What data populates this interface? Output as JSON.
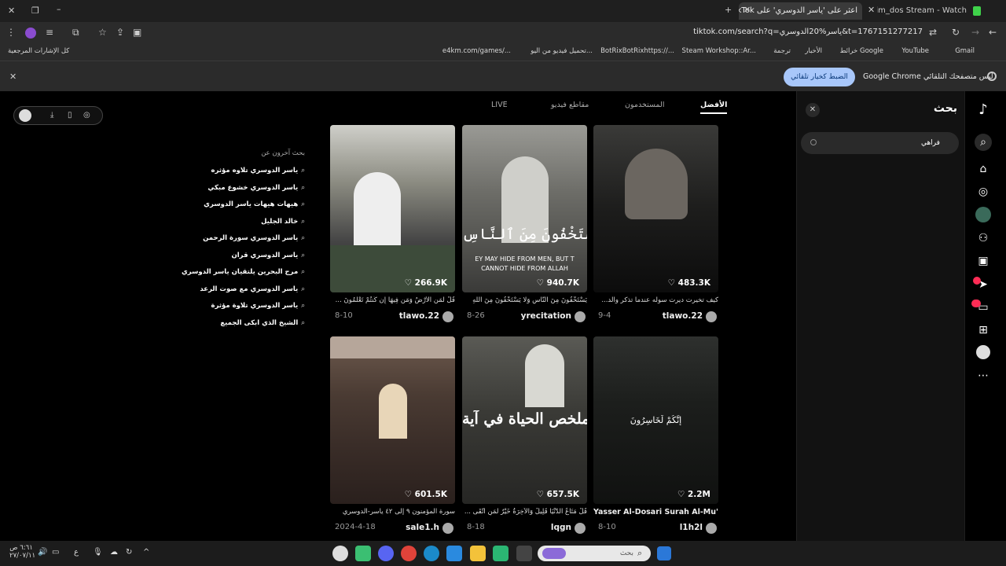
{
  "browser": {
    "tabs": [
      {
        "title": "ibrahim_dos Stream - Watch",
        "active": false
      },
      {
        "title": "اعثر على 'ياسر الدوسري' على TikTok",
        "active": true
      }
    ],
    "url": "tiktok.com/search?q=ياسر%20الدوسري&t=1767151277217",
    "bookmarks": [
      "Gmail",
      "YouTube",
      "خرائط Google",
      "الأخبار",
      "ترجمة",
      "Steam Workshop::Ar...",
      "BotRixBotRixhttps://...",
      "تحميل فيديو من اليو...",
      "e4km.com/games/...",
      "كل الإشارات المرجعية"
    ],
    "infobar": {
      "text": "Google Chrome ليس متصفحك التلقائي",
      "button": "الضبط كخيار تلقائي"
    }
  },
  "search_panel": {
    "title": "بحث",
    "query": "فراهي"
  },
  "tabs": [
    "الأفضل",
    "المستخدمون",
    "مقاطع فيديو",
    "LIVE"
  ],
  "videos": [
    {
      "likes": "266.9K",
      "desc": "قُلْ لِّمَن الأَرْضُ وَمَن فِيهَا إِن كُنتُمْ تَعْلَمُونَ ...",
      "author": "tlawo.22",
      "date": "8-10",
      "overlay": ""
    },
    {
      "likes": "940.7K",
      "desc": "يَسْتَخْفُونَ مِنَ النَّاسِ وَلَا يَسْتَخْفُونَ مِنَ اللَّهِ",
      "author": "yrecitation",
      "date": "8-26",
      "overlay": "يَسْتَخْفُونَ مِنَ ٱلنَّاسِ",
      "overlay2": "EY MAY HIDE FROM MEN, BUT T CANNOT HIDE FROM ALLAH"
    },
    {
      "likes": "483.3K",
      "desc": "كيف تخيرت ديرت سوله عندما تذكر والد...",
      "author": "tlawo.22",
      "date": "9-4",
      "overlay": ""
    },
    {
      "likes": "601.5K",
      "desc": "سورة المؤمنون ٩ إلى ٤٢ ياسر-الدوسري",
      "author": "sale1.h",
      "date": "2024-4-18",
      "overlay": ""
    },
    {
      "likes": "657.5K",
      "desc": "قُلْ مَتَاعُ الدُّنْيَا قَلِيلٌ وَالْآخِرَةُ خَيْرٌ لِّمَنِ اتَّقَى ...",
      "author": "lqgn",
      "date": "8-18",
      "overlay": "ملخص الحياة في آية"
    },
    {
      "likes": "2.2M",
      "desc": "Yasser Al-Dosari Surah Al-Mu'minoon",
      "author": "l1h2l",
      "date": "8-10",
      "overlay": "إِنَّكُمْ لَخَاسِرُونَ"
    }
  ],
  "related": {
    "title": "بحث آخرون عن",
    "items": [
      "ياسر الدوسري تلاوه مؤثره",
      "ياسر الدوسري خشوع مبكي",
      "هيهات هيهات ياسر الدوسري",
      "خالد الجليل",
      "ياسر الدوسري سورة الرحمن",
      "ياسر الدوسري قران",
      "مرج البحرين يلتقيان ياسر الدوسري",
      "ياسر الدوسري مع صوت الرعد",
      "ياسر الدوسري تلاوة مؤثرة",
      "الشيخ الذي ابكى الجميع"
    ]
  },
  "taskbar": {
    "search_placeholder": "بحث",
    "time": "٦:٦١ ص",
    "date": "٢٧/٠٧/١١",
    "lang": "ع"
  },
  "colors": {
    "accent": "#a8c7fa",
    "tiktok_red": "#fe2c55"
  }
}
